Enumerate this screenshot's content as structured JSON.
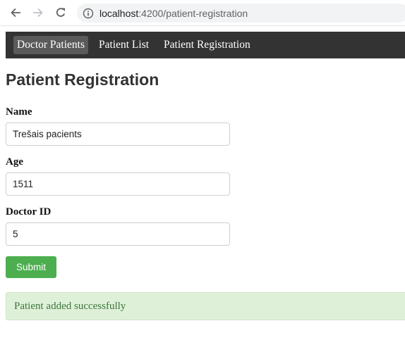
{
  "browser": {
    "url_host": "localhost",
    "url_rest": ":4200/patient-registration"
  },
  "nav": {
    "links": [
      {
        "label": "Doctor Patients"
      },
      {
        "label": "Patient List"
      },
      {
        "label": "Patient Registration"
      }
    ]
  },
  "page": {
    "title": "Patient Registration"
  },
  "form": {
    "name_label": "Name",
    "name_value": "Trešais pacients",
    "age_label": "Age",
    "age_value": "1511",
    "doctor_id_label": "Doctor ID",
    "doctor_id_value": "5",
    "submit_label": "Submit"
  },
  "alert": {
    "message": "Patient added successfully"
  },
  "colors": {
    "navbar": "#333333",
    "submit": "#4cae4f",
    "alert_bg": "#dff0d8",
    "alert_text": "#3c763d"
  }
}
